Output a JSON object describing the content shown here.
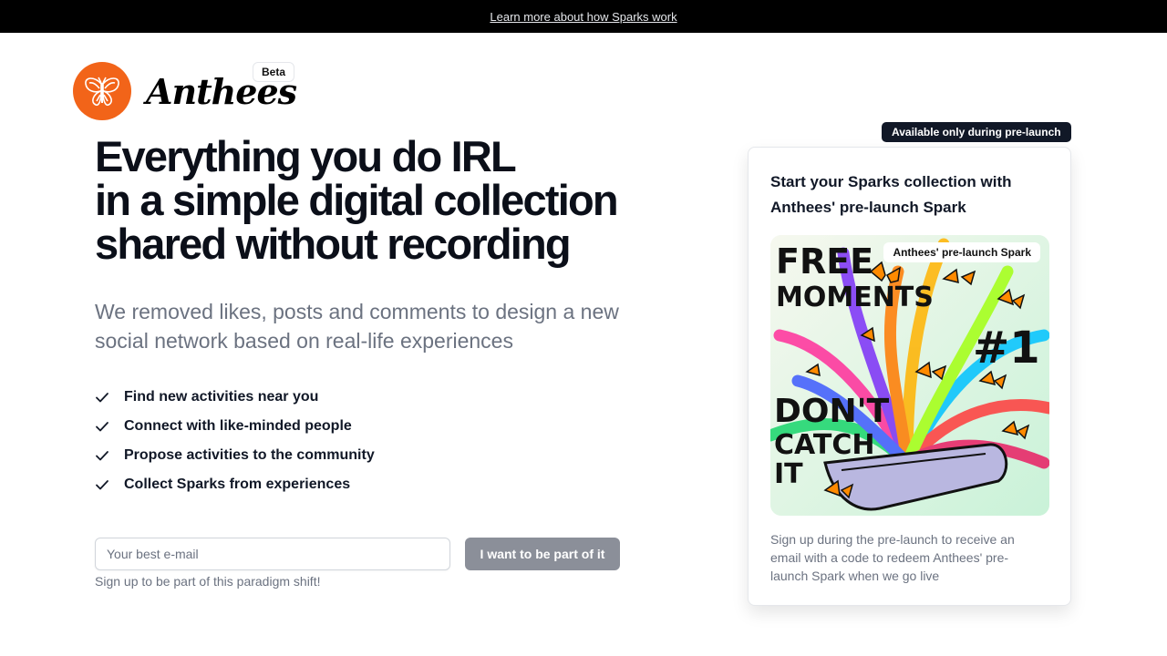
{
  "topbar": {
    "link_text": "Learn more about how Sparks work"
  },
  "brand": {
    "name": "Anthees",
    "beta_label": "Beta",
    "logo_color": "#f26419",
    "logo_icon": "butterfly-icon"
  },
  "hero": {
    "headline_lines": [
      "Everything you do IRL",
      "in a simple digital collection",
      "shared without recording"
    ],
    "subhead": "We removed likes, posts and comments to design a new social network based on real-life experiences"
  },
  "features": [
    "Find new activities near you",
    "Connect with like-minded people",
    "Propose activities to the community",
    "Collect Sparks from experiences"
  ],
  "signup": {
    "email_placeholder": "Your best e-mail",
    "email_value": "",
    "button_label": "I want to be part of it",
    "helper_text": "Sign up to be part of this paradigm shift!",
    "button_color": "#8b8f99"
  },
  "card": {
    "badge": "Available only during pre-launch",
    "title": "Start your Sparks collection with Anthees' pre-launch Spark",
    "image_label": "Anthees' pre-launch Spark",
    "image_text": {
      "top_left": [
        "FREE",
        "MOMENTS"
      ],
      "right": "#1",
      "bottom_left": [
        "DON'T",
        "CATCH",
        "IT"
      ]
    },
    "description": "Sign up during the pre-launch to receive an email with a code to redeem Anthees' pre-launch Spark when we go live"
  }
}
